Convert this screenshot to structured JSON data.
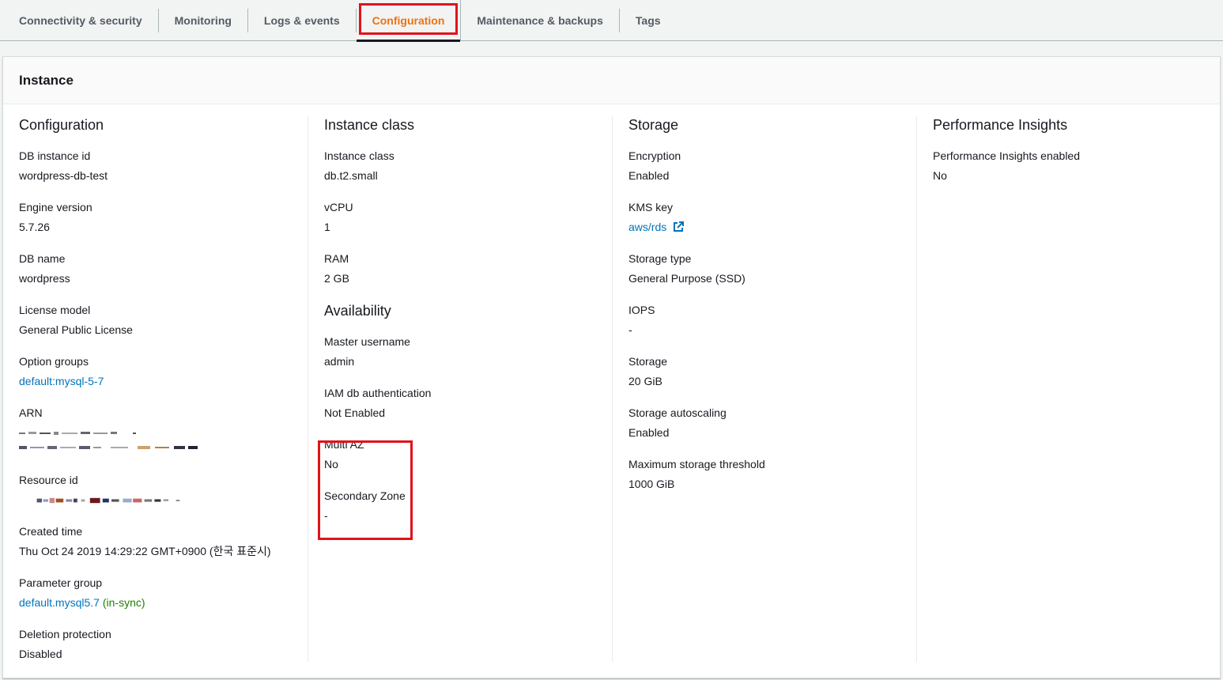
{
  "tabs": [
    {
      "label": "Connectivity & security"
    },
    {
      "label": "Monitoring"
    },
    {
      "label": "Logs & events"
    },
    {
      "label": "Configuration"
    },
    {
      "label": "Maintenance & backups"
    },
    {
      "label": "Tags"
    }
  ],
  "panel": {
    "title": "Instance"
  },
  "configuration": {
    "heading": "Configuration",
    "db_instance_id": {
      "label": "DB instance id",
      "value": "wordpress-db-test"
    },
    "engine_version": {
      "label": "Engine version",
      "value": "5.7.26"
    },
    "db_name": {
      "label": "DB name",
      "value": "wordpress"
    },
    "license_model": {
      "label": "License model",
      "value": "General Public License"
    },
    "option_groups": {
      "label": "Option groups",
      "value": "default:mysql-5-7"
    },
    "arn": {
      "label": "ARN"
    },
    "resource_id": {
      "label": "Resource id"
    },
    "created_time": {
      "label": "Created time",
      "value": "Thu Oct 24 2019 14:29:22 GMT+0900 (한국 표준시)"
    },
    "parameter_group": {
      "label": "Parameter group",
      "value": "default.mysql5.7",
      "status": "(in-sync)"
    },
    "deletion_protection": {
      "label": "Deletion protection",
      "value": "Disabled"
    }
  },
  "instance_class": {
    "heading": "Instance class",
    "instance_class": {
      "label": "Instance class",
      "value": "db.t2.small"
    },
    "vcpu": {
      "label": "vCPU",
      "value": "1"
    },
    "ram": {
      "label": "RAM",
      "value": "2 GB"
    }
  },
  "availability": {
    "heading": "Availability",
    "master_username": {
      "label": "Master username",
      "value": "admin"
    },
    "iam_auth": {
      "label": "IAM db authentication",
      "value": "Not Enabled"
    },
    "multi_az": {
      "label": "Multi AZ",
      "value": "No"
    },
    "secondary_zone": {
      "label": "Secondary Zone",
      "value": "-"
    }
  },
  "storage": {
    "heading": "Storage",
    "encryption": {
      "label": "Encryption",
      "value": "Enabled"
    },
    "kms_key": {
      "label": "KMS key",
      "value": "aws/rds"
    },
    "storage_type": {
      "label": "Storage type",
      "value": "General Purpose (SSD)"
    },
    "iops": {
      "label": "IOPS",
      "value": "-"
    },
    "storage": {
      "label": "Storage",
      "value": "20 GiB"
    },
    "autoscaling": {
      "label": "Storage autoscaling",
      "value": "Enabled"
    },
    "max_threshold": {
      "label": "Maximum storage threshold",
      "value": "1000 GiB"
    }
  },
  "performance_insights": {
    "heading": "Performance Insights",
    "enabled": {
      "label": "Performance Insights enabled",
      "value": "No"
    }
  },
  "colors": {
    "active_tab": "#ec7211",
    "link": "#0073bb",
    "in_sync": "#1d8102",
    "highlight": "#e0131b"
  }
}
